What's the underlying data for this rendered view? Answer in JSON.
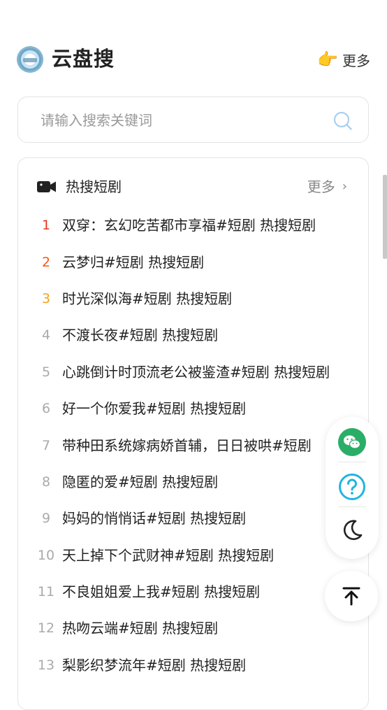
{
  "header": {
    "title": "云盘搜",
    "more_label": "更多"
  },
  "search": {
    "placeholder": "请输入搜索关键词",
    "value": ""
  },
  "hot_section": {
    "title": "热搜短剧",
    "more_label": "更多",
    "items": [
      {
        "rank": "1",
        "title": "双穿：玄幻吃苦都市享福#短剧 热搜短剧"
      },
      {
        "rank": "2",
        "title": "云梦归#短剧 热搜短剧"
      },
      {
        "rank": "3",
        "title": "时光深似海#短剧 热搜短剧"
      },
      {
        "rank": "4",
        "title": "不渡长夜#短剧 热搜短剧"
      },
      {
        "rank": "5",
        "title": "心跳倒计时顶流老公被鉴渣#短剧 热搜短剧"
      },
      {
        "rank": "6",
        "title": "好一个你爱我#短剧 热搜短剧"
      },
      {
        "rank": "7",
        "title": "带种田系统嫁病娇首辅，日日被哄#短剧"
      },
      {
        "rank": "8",
        "title": "隐匿的爱#短剧 热搜短剧"
      },
      {
        "rank": "9",
        "title": "妈妈的悄悄话#短剧 热搜短剧"
      },
      {
        "rank": "10",
        "title": "天上掉下个武财神#短剧 热搜短剧"
      },
      {
        "rank": "11",
        "title": "不良姐姐爱上我#短剧 热搜短剧"
      },
      {
        "rank": "12",
        "title": "热吻云端#短剧 热搜短剧"
      },
      {
        "rank": "13",
        "title": "梨影织梦流年#短剧 热搜短剧"
      }
    ]
  },
  "icons": {
    "logo": "site-logo",
    "more": "pointing-hand-icon",
    "search": "search-icon",
    "section": "video-camera-icon",
    "chevron": "chevron-right-icon",
    "tools": [
      "wechat-icon",
      "help-icon",
      "moon-icon",
      "back-to-top-icon"
    ]
  },
  "colors": {
    "rank1": "#e8341f",
    "rank2": "#f25a14",
    "rank3": "#f5a11a",
    "rank_other": "#aaaaaa",
    "wechat": "#2aae67",
    "help": "#1fb5e0"
  }
}
